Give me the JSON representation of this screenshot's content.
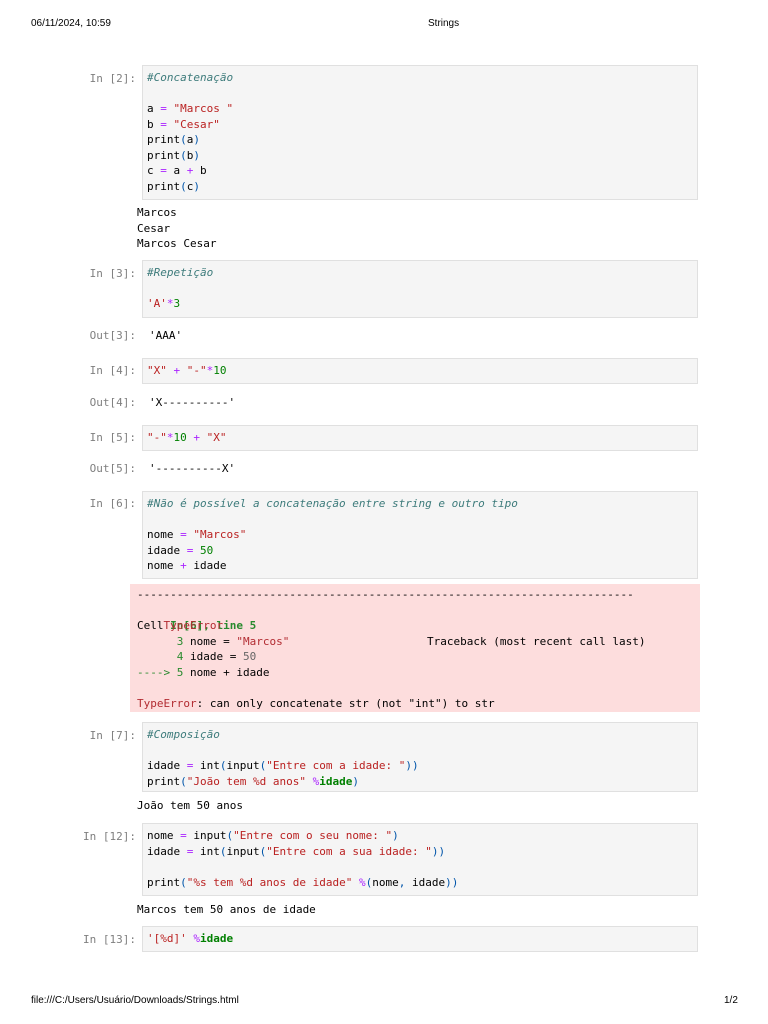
{
  "header": {
    "datetime": "06/11/2024, 10:59",
    "title": "Strings"
  },
  "footer": {
    "path": "file:///C:/Users/Usuário/Downloads/Strings.html",
    "page": "1/2"
  },
  "cells": {
    "c2": {
      "prompt": "In [2]:",
      "comment": "#Concatenação",
      "output": [
        "Marcos",
        "Cesar",
        "Marcos Cesar"
      ]
    },
    "c3": {
      "prompt": "In [3]:",
      "comment": "#Repetição",
      "out_prompt": "Out[3]:",
      "out": "'AAA'"
    },
    "c4": {
      "prompt": "In [4]:",
      "out_prompt": "Out[4]:",
      "out": "'X----------'"
    },
    "c5": {
      "prompt": "In [5]:",
      "out_prompt": "Out[5]:",
      "out": "'----------X'"
    },
    "c6": {
      "prompt": "In [6]:",
      "comment": "#Não é possível a concatenação entre string e outro tipo",
      "error": {
        "rule": "---------------------------------------------------------------------------",
        "name": "TypeError",
        "traceback": "Traceback (most recent call last)",
        "cell": "Cell ",
        "cell_ref": "In[6], line 5",
        "l3": "      3",
        "l3_code": " nome = ",
        "l3_str": "\"Marcos\"",
        "l4": "      4",
        "l4_code": " idade = ",
        "l4_num": "50",
        "arrow": "----> 5",
        "l5_code": " nome + idade",
        "msg": ": can only concatenate str (not \"int\") to str"
      }
    },
    "c7": {
      "prompt": "In [7]:",
      "comment": "#Composição",
      "output": [
        "João tem 50 anos"
      ]
    },
    "c12": {
      "prompt": "In [12]:",
      "output": [
        "Marcos tem 50 anos de idade"
      ]
    },
    "c13": {
      "prompt": "In [13]:"
    }
  }
}
